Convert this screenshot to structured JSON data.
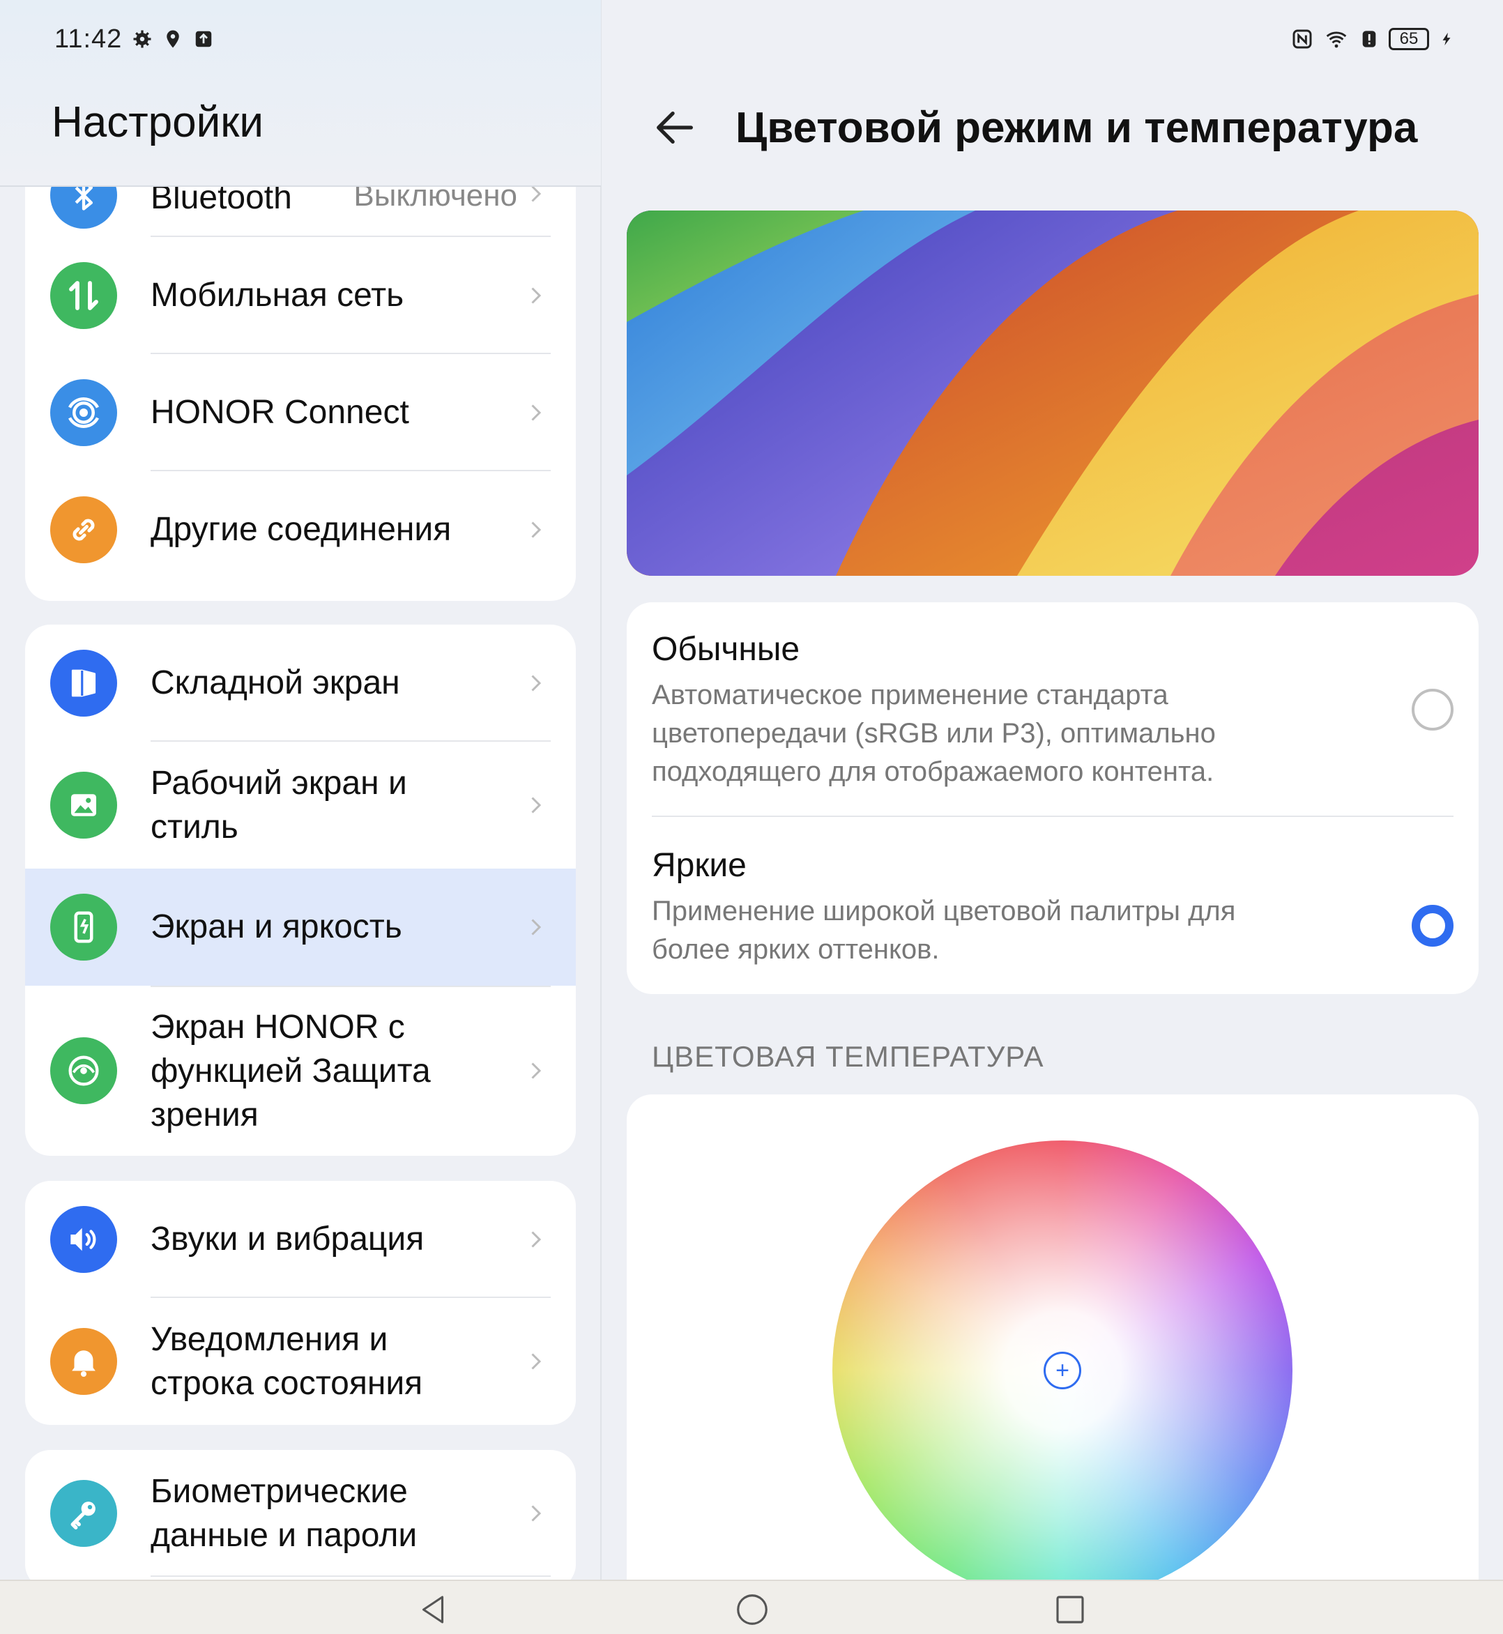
{
  "status_bar": {
    "time": "11:42",
    "left_icons": [
      "gear-icon",
      "location-icon",
      "upload-icon"
    ],
    "right_icons": [
      "nfc-icon",
      "wifi-icon",
      "alert-icon",
      "battery-icon",
      "charging-icon"
    ],
    "battery": "65"
  },
  "settings": {
    "title": "Настройки",
    "groups": [
      {
        "items": [
          {
            "label": "Bluetooth",
            "value": "Выключено",
            "icon": "bluetooth-icon",
            "color": "#3a8ee6"
          },
          {
            "label": "Мобильная сеть",
            "icon": "mobile-data-icon",
            "color": "#3fb860"
          },
          {
            "label": "HONOR Connect",
            "icon": "honor-connect-icon",
            "color": "#3a8ee6"
          },
          {
            "label": "Другие соединения",
            "icon": "link-icon",
            "color": "#f0962f"
          }
        ]
      },
      {
        "items": [
          {
            "label": "Складной экран",
            "icon": "fold-screen-icon",
            "color": "#2f6cf0"
          },
          {
            "label": "Рабочий экран и стиль",
            "icon": "wallpaper-icon",
            "color": "#3fb860"
          },
          {
            "label": "Экран и яркость",
            "icon": "display-icon",
            "color": "#3fb860",
            "selected": true
          },
          {
            "label": "Экран HONOR с функцией Защита зрения",
            "icon": "eye-comfort-icon",
            "color": "#3fb860"
          }
        ]
      },
      {
        "items": [
          {
            "label": "Звуки и вибрация",
            "icon": "sound-icon",
            "color": "#2f6cf0"
          },
          {
            "label": "Уведомления и строка состояния",
            "icon": "bell-icon",
            "color": "#f0962f"
          }
        ]
      },
      {
        "items": [
          {
            "label": "Биометрические данные и пароли",
            "icon": "key-icon",
            "color": "#3ab5c8"
          }
        ]
      }
    ]
  },
  "detail": {
    "title": "Цветовой режим и температура",
    "back_icon": "back-arrow-icon",
    "modes": [
      {
        "title": "Обычные",
        "description": "Автоматическое применение стандарта цветопередачи (sRGB или P3), оптимально подходящего для отображаемого контента.",
        "selected": false
      },
      {
        "title": "Яркие",
        "description": "Применение широкой цветовой палитры для более ярких оттенков.",
        "selected": true
      }
    ],
    "temperature_section": "ЦВЕТОВАЯ ТЕМПЕРАТУРА",
    "wheel_marker": "+"
  },
  "navbar": {
    "buttons": [
      "back-triangle-icon",
      "home-circle-icon",
      "recents-square-icon"
    ]
  }
}
